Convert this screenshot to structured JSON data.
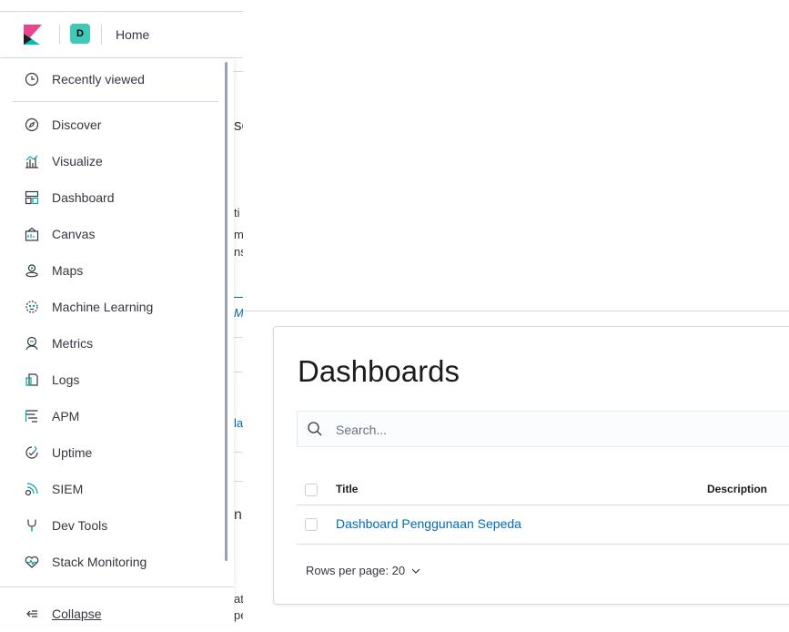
{
  "header": {
    "space_initial": "D",
    "home_label": "Home"
  },
  "nav": {
    "recently_viewed": "Recently viewed",
    "items": [
      {
        "label": "Discover",
        "icon": "compass-icon"
      },
      {
        "label": "Visualize",
        "icon": "visualize-icon"
      },
      {
        "label": "Dashboard",
        "icon": "dashboard-icon"
      },
      {
        "label": "Canvas",
        "icon": "canvas-icon"
      },
      {
        "label": "Maps",
        "icon": "maps-icon"
      },
      {
        "label": "Machine Learning",
        "icon": "machine-learning-icon"
      },
      {
        "label": "Metrics",
        "icon": "metrics-icon"
      },
      {
        "label": "Logs",
        "icon": "logs-icon"
      },
      {
        "label": "APM",
        "icon": "apm-icon"
      },
      {
        "label": "Uptime",
        "icon": "uptime-icon"
      },
      {
        "label": "SIEM",
        "icon": "siem-icon"
      },
      {
        "label": "Dev Tools",
        "icon": "dev-tools-icon"
      },
      {
        "label": "Stack Monitoring",
        "icon": "stack-monitoring-icon"
      }
    ],
    "collapse_label": "Collapse"
  },
  "background": {
    "fragments": [
      "se",
      "ti",
      "m",
      "ns",
      "M",
      "la",
      "n",
      "at",
      "pe"
    ]
  },
  "dashboards": {
    "title": "Dashboards",
    "search_placeholder": "Search...",
    "columns": {
      "title": "Title",
      "description": "Description"
    },
    "rows": [
      {
        "title": "Dashboard Penggunaan Sepeda",
        "description": ""
      }
    ],
    "rows_per_page": "Rows per page: 20"
  },
  "colors": {
    "accent_link": "#006bb4",
    "space_avatar": "#3ec9b8",
    "border": "#d3dae6"
  }
}
